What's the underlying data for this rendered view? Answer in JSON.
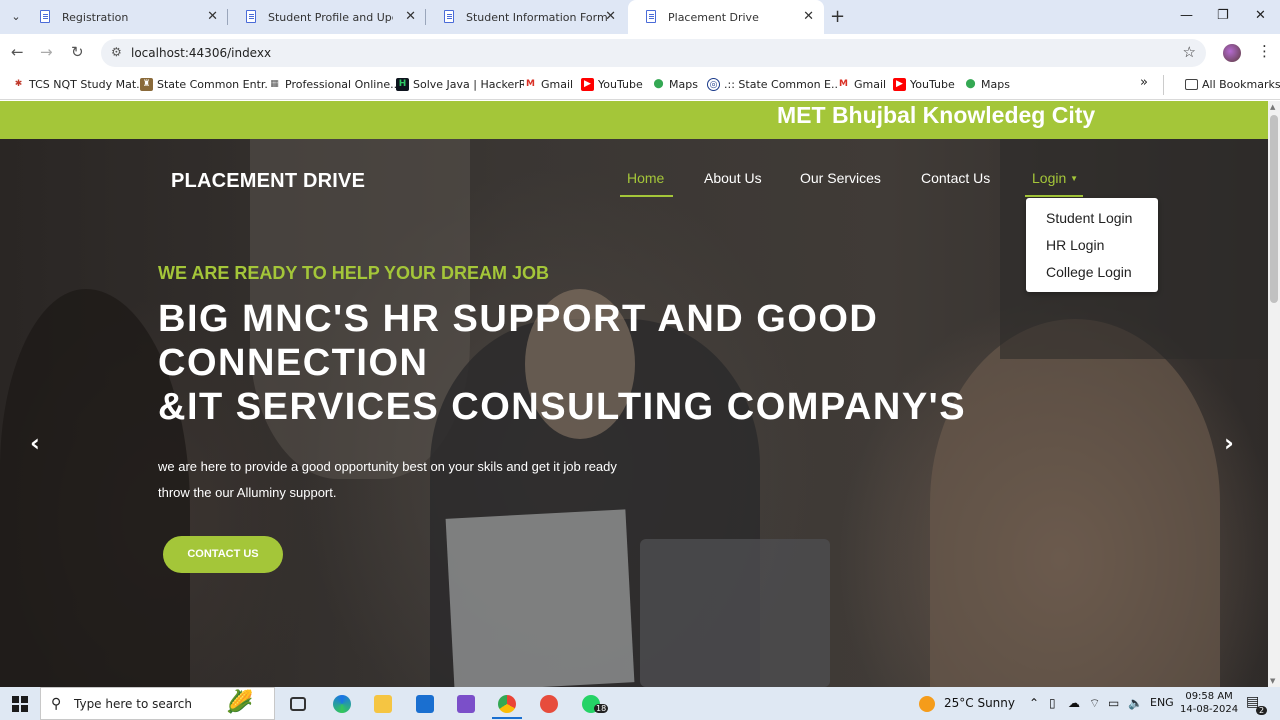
{
  "browser": {
    "tabs": [
      {
        "title": "Registration"
      },
      {
        "title": "Student Profile and Upcoming D"
      },
      {
        "title": "Student Information Form"
      },
      {
        "title": "Placement Drive"
      }
    ],
    "url": "localhost:44306/indexx",
    "bookmarks": [
      "TCS NQT Study Mat...",
      "State Common Entr...",
      "Professional Online...",
      "Solve Java | HackerR...",
      "Gmail",
      "YouTube",
      "Maps",
      ".:: State Common E...",
      "Gmail",
      "YouTube",
      "Maps"
    ],
    "all_bookmarks": "All Bookmarks"
  },
  "site": {
    "banner": "MET Bhujbal Knowledeg City",
    "brand": "PLACEMENT DRIVE",
    "nav": [
      "Home",
      "About Us",
      "Our Services",
      "Contact Us",
      "Login"
    ],
    "login_menu": [
      "Student Login",
      "HR Login",
      "College Login"
    ],
    "kicker": "WE ARE READY TO HELP YOUR DREAM JOB",
    "headline_1": "BIG MNC'S HR SUPPORT AND GOOD",
    "headline_2": "CONNECTION",
    "headline_3": "&IT SERVICES CONSULTING COMPANY'S",
    "desc": "we are here to provide a good opportunity best on your skils and get it job ready throw the our Alluminy support.",
    "cta": "CONTACT US",
    "prev": "‹",
    "next": "›"
  },
  "taskbar": {
    "search_placeholder": "Type here to search",
    "weather": "25°C  Sunny",
    "lang": "ENG",
    "time": "09:58 AM",
    "date": "14-08-2024",
    "whatsapp_badge": "18",
    "notif_badge": "2"
  },
  "colors": {
    "accent": "#a4c639"
  }
}
